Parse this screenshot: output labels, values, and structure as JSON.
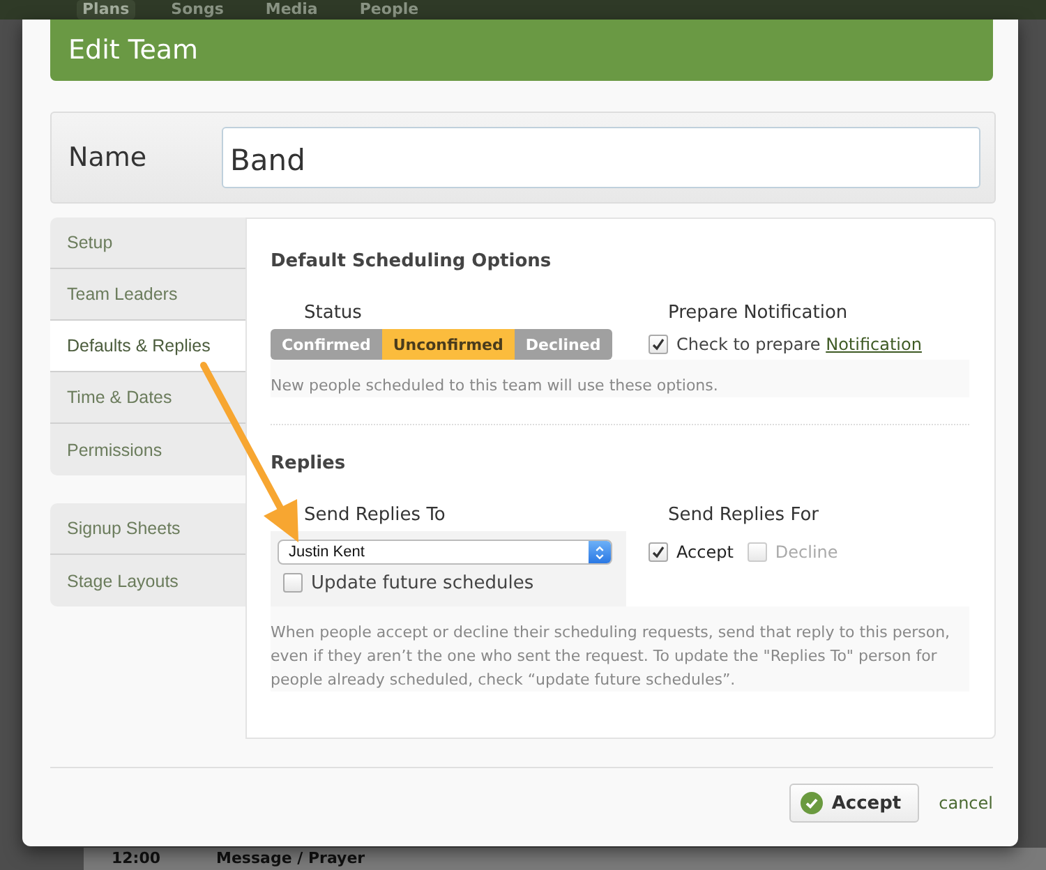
{
  "background": {
    "nav_tabs": [
      {
        "label": "Plans",
        "selected": true
      },
      {
        "label": "Songs",
        "selected": false
      },
      {
        "label": "Media",
        "selected": false
      },
      {
        "label": "People",
        "selected": false
      }
    ],
    "rows": [
      {
        "time": "12:00",
        "title": "Message / Prayer"
      }
    ]
  },
  "dialog": {
    "title": "Edit Team",
    "name": {
      "label": "Name",
      "value": "Band"
    },
    "sidebar": {
      "groups": [
        {
          "items": [
            {
              "label": "Setup",
              "selected": false
            },
            {
              "label": "Team Leaders",
              "selected": false
            },
            {
              "label": "Defaults & Replies",
              "selected": true
            },
            {
              "label": "Time & Dates",
              "selected": false
            },
            {
              "label": "Permissions",
              "selected": false
            }
          ]
        },
        {
          "items": [
            {
              "label": "Signup Sheets",
              "selected": false
            },
            {
              "label": "Stage Layouts",
              "selected": false
            }
          ]
        }
      ]
    },
    "defaults": {
      "heading": "Default Scheduling Options",
      "status_label": "Status",
      "status_options": [
        {
          "label": "Confirmed",
          "selected": false
        },
        {
          "label": "Unconfirmed",
          "selected": true
        },
        {
          "label": "Declined",
          "selected": false
        }
      ],
      "notification_label": "Prepare Notification",
      "notification_checkbox": {
        "checked": true,
        "text": "Check to prepare",
        "link": "Notification"
      },
      "hint": "New people scheduled to this team will use these options."
    },
    "replies": {
      "heading": "Replies",
      "send_to_label": "Send Replies To",
      "send_to_value": "Justin Kent",
      "update_future": {
        "label": "Update future schedules",
        "checked": false
      },
      "send_for_label": "Send Replies For",
      "send_for_options": [
        {
          "label": "Accept",
          "checked": true,
          "disabled": false
        },
        {
          "label": "Decline",
          "checked": false,
          "disabled": true
        }
      ],
      "hint": "When people accept or decline their scheduling requests, send that reply to this person, even if they aren’t the one who sent the request. To update the \"Replies To\" person for people already scheduled, check “update future schedules”."
    },
    "buttons": {
      "accept": "Accept",
      "cancel": "cancel"
    }
  }
}
